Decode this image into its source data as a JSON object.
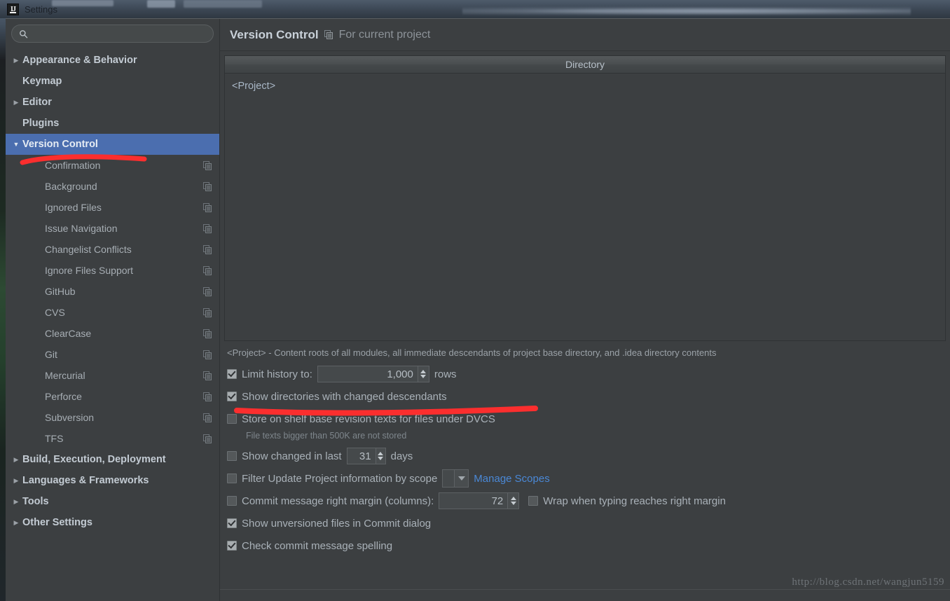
{
  "window": {
    "title": "Settings",
    "logo_text": "IJ"
  },
  "search": {
    "value": "",
    "placeholder": "",
    "icon": "search-icon"
  },
  "sidebar": {
    "items": [
      {
        "label": "Appearance & Behavior",
        "level": "top",
        "arrow": "▶",
        "selected": false,
        "copy": false
      },
      {
        "label": "Keymap",
        "level": "top",
        "arrow": "",
        "selected": false,
        "copy": false
      },
      {
        "label": "Editor",
        "level": "top",
        "arrow": "▶",
        "selected": false,
        "copy": false
      },
      {
        "label": "Plugins",
        "level": "top",
        "arrow": "",
        "selected": false,
        "copy": false
      },
      {
        "label": "Version Control",
        "level": "top",
        "arrow": "▼",
        "selected": true,
        "copy": false
      },
      {
        "label": "Confirmation",
        "level": "child",
        "arrow": "",
        "selected": false,
        "copy": true
      },
      {
        "label": "Background",
        "level": "child",
        "arrow": "",
        "selected": false,
        "copy": true
      },
      {
        "label": "Ignored Files",
        "level": "child",
        "arrow": "",
        "selected": false,
        "copy": true
      },
      {
        "label": "Issue Navigation",
        "level": "child",
        "arrow": "",
        "selected": false,
        "copy": true
      },
      {
        "label": "Changelist Conflicts",
        "level": "child",
        "arrow": "",
        "selected": false,
        "copy": true
      },
      {
        "label": "Ignore Files Support",
        "level": "child",
        "arrow": "",
        "selected": false,
        "copy": true
      },
      {
        "label": "GitHub",
        "level": "child",
        "arrow": "",
        "selected": false,
        "copy": true
      },
      {
        "label": "CVS",
        "level": "child",
        "arrow": "",
        "selected": false,
        "copy": true
      },
      {
        "label": "ClearCase",
        "level": "child",
        "arrow": "",
        "selected": false,
        "copy": true
      },
      {
        "label": "Git",
        "level": "child",
        "arrow": "",
        "selected": false,
        "copy": true
      },
      {
        "label": "Mercurial",
        "level": "child",
        "arrow": "",
        "selected": false,
        "copy": true
      },
      {
        "label": "Perforce",
        "level": "child",
        "arrow": "",
        "selected": false,
        "copy": true
      },
      {
        "label": "Subversion",
        "level": "child",
        "arrow": "",
        "selected": false,
        "copy": true
      },
      {
        "label": "TFS",
        "level": "child",
        "arrow": "",
        "selected": false,
        "copy": true
      },
      {
        "label": "Build, Execution, Deployment",
        "level": "top",
        "arrow": "▶",
        "selected": false,
        "copy": false
      },
      {
        "label": "Languages & Frameworks",
        "level": "top",
        "arrow": "▶",
        "selected": false,
        "copy": false
      },
      {
        "label": "Tools",
        "level": "top",
        "arrow": "▶",
        "selected": false,
        "copy": false
      },
      {
        "label": "Other Settings",
        "level": "top",
        "arrow": "▶",
        "selected": false,
        "copy": false
      }
    ]
  },
  "main": {
    "page_title": "Version Control",
    "scope_label": "For current project",
    "directory_table": {
      "column_header": "Directory",
      "rows": [
        "<Project>"
      ]
    },
    "description": "<Project> - Content roots of all modules, all immediate descendants of project base directory, and .idea directory contents",
    "options": {
      "limit_history": {
        "label": "Limit history to:",
        "checked": true,
        "value": "1,000",
        "suffix": "rows"
      },
      "show_directories": {
        "label": "Show directories with changed descendants",
        "checked": true
      },
      "store_on_shelf": {
        "label": "Store on shelf base revision texts for files under DVCS",
        "checked": false,
        "note": "File texts bigger than 500K are not stored"
      },
      "show_changed_in_last": {
        "label": "Show changed in last",
        "checked": false,
        "value": "31",
        "suffix": "days"
      },
      "filter_by_scope": {
        "label": "Filter Update Project information by scope",
        "checked": false,
        "combo_value": "",
        "link": "Manage Scopes"
      },
      "commit_right_margin": {
        "label": "Commit message right margin (columns):",
        "checked": false,
        "value": "72"
      },
      "wrap_when_typing": {
        "label": "Wrap when typing reaches right margin",
        "checked": false
      },
      "show_unversioned": {
        "label": "Show unversioned files in Commit dialog",
        "checked": true
      },
      "check_spelling": {
        "label": "Check commit message spelling",
        "checked": true
      }
    }
  },
  "watermark": {
    "text": "http://blog.csdn.net/wangjun5159"
  },
  "colors": {
    "accent_selection": "#4b6eaf",
    "panel_bg": "#3c3f41",
    "text": "#a9b7c6",
    "link": "#4a88d6",
    "annotation": "#fb2e2e"
  }
}
